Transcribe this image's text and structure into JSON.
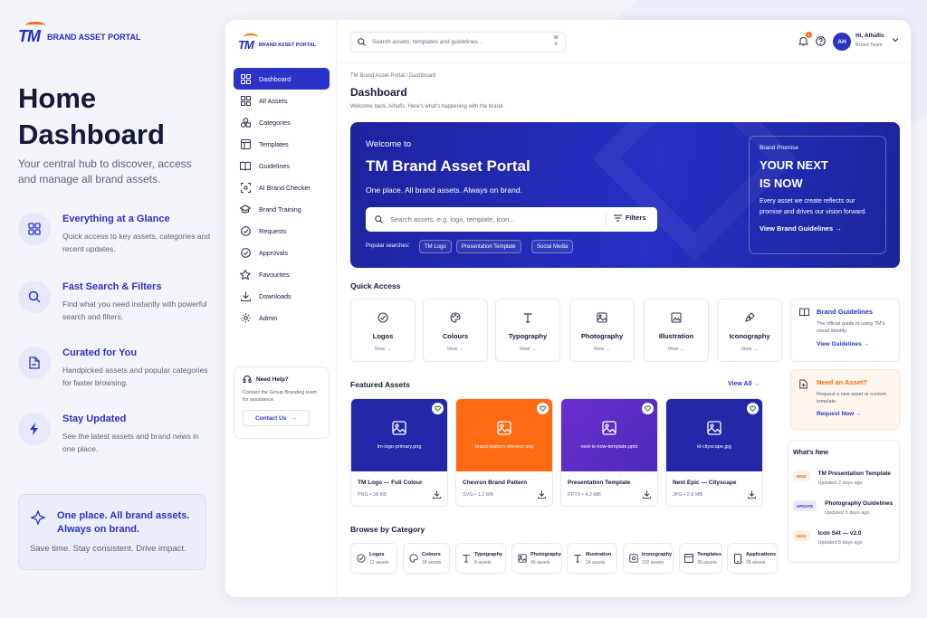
{
  "brand": {
    "logo": "TM",
    "portal_name": "BRAND ASSET PORTAL"
  },
  "hero_left": {
    "title_line1": "Home",
    "title_line2": "Dashboard",
    "subtitle": "Your central hub to discover, access and manage all brand assets.",
    "features": [
      {
        "icon": "grid-icon",
        "title": "Everything at a Glance",
        "text": "Quick access to key assets, categories and recent updates."
      },
      {
        "icon": "search-icon",
        "title": "Fast Search & Filters",
        "text": "Find what you need instantly with powerful search and filters."
      },
      {
        "icon": "document-icon",
        "title": "Curated for You",
        "text": "Handpicked assets and popular categories for faster browsing."
      },
      {
        "icon": "lightning-icon",
        "title": "Stay Updated",
        "text": "See the latest assets and brand news in one place."
      }
    ],
    "promo": {
      "title": "One place. All brand assets. Always on brand.",
      "text": "Save time. Stay consistent. Drive impact."
    }
  },
  "sidebar": {
    "items": [
      {
        "label": "Dashboard",
        "icon": "grid-icon",
        "active": true
      },
      {
        "label": "All Assets",
        "icon": "layers-icon"
      },
      {
        "label": "Categories",
        "icon": "shapes-icon"
      },
      {
        "label": "Templates",
        "icon": "template-icon"
      },
      {
        "label": "Guidelines",
        "icon": "book-icon"
      },
      {
        "label": "AI Brand Checker",
        "icon": "scan-icon"
      },
      {
        "label": "Brand Training",
        "icon": "graduation-cap-icon"
      },
      {
        "label": "Requests",
        "icon": "check-circle-icon"
      },
      {
        "label": "Approvals",
        "icon": "check-circle-icon"
      },
      {
        "label": "Favourites",
        "icon": "star-icon"
      },
      {
        "label": "Downloads",
        "icon": "download-icon"
      },
      {
        "label": "Admin",
        "icon": "gear-icon"
      }
    ],
    "help": {
      "title": "Need Help?",
      "text": "Contact the Group Branding team for assistance.",
      "button": "Contact Us"
    }
  },
  "topbar": {
    "search_placeholder": "Search assets, templates and guidelines...",
    "shortcut_1": "⌘",
    "shortcut_2": "K",
    "notification_count": "1",
    "user": {
      "initials": "AH",
      "name": "Hi, Alhafis",
      "role": "Brand Team"
    }
  },
  "main": {
    "breadcrumb": "TM Brand Asset Portal  /  Dashboard",
    "title": "Dashboard",
    "subtitle": "Welcome back, Alhafis. Here's what's happening with the brand.",
    "hero": {
      "welcome": "Welcome to",
      "title": "TM Brand Asset Portal",
      "tagline": "One place. All brand assets. Always on brand.",
      "search_placeholder": "Search assets, e.g. logo, template, icon...",
      "filters": "Filters",
      "popular_label": "Popular searches:",
      "popular": [
        "TM Logo",
        "Presentation Template",
        "Social Media"
      ],
      "promise": {
        "label": "Brand Promise",
        "title_line1": "YOUR NEXT",
        "title_line2": "IS NOW",
        "text": "Every asset we create reflects our promise and drives our vision forward.",
        "link": "View Brand Guidelines →"
      }
    },
    "quick_access": {
      "title": "Quick Access",
      "items": [
        {
          "label": "Logos",
          "icon": "logo-icon",
          "link": "View →"
        },
        {
          "label": "Colours",
          "icon": "palette-icon",
          "link": "View →"
        },
        {
          "label": "Typography",
          "icon": "typography-icon",
          "link": "View →"
        },
        {
          "label": "Photography",
          "icon": "image-icon",
          "link": "View →"
        },
        {
          "label": "Illustration",
          "icon": "illustration-icon",
          "link": "View →"
        },
        {
          "label": "Iconography",
          "icon": "pen-icon",
          "link": "View →"
        }
      ]
    },
    "brand_guidelines": {
      "title": "Brand Guidelines",
      "text": "The official guide to using TM's visual identity.",
      "link": "View Guidelines →"
    },
    "need_asset": {
      "title": "Need an Asset?",
      "text": "Request a new asset or custom template.",
      "link": "Request Now →"
    },
    "featured": {
      "title": "Featured Assets",
      "view_all": "View All →",
      "items": [
        {
          "filename": "tm-logo-primary.png",
          "title": "TM Logo — Full Colour",
          "meta": "PNG • 28 KB",
          "color": "#2327a8"
        },
        {
          "filename": "brand-pattern-chevron.svg",
          "title": "Chevron Brand Pattern",
          "meta": "SVG • 1.2 MB",
          "color": "#ff6a13"
        },
        {
          "filename": "next-is-now-template.pptx",
          "title": "Presentation Template",
          "meta": "PPTX • 4.2 MB",
          "color": "#5b2bc6"
        },
        {
          "filename": "kl-cityscape.jpg",
          "title": "Next Epic — Cityscape",
          "meta": "JPG • 2.8 MB",
          "color": "#2327a8"
        }
      ]
    },
    "whats_new": {
      "title": "What's New",
      "items": [
        {
          "badge": "NEW",
          "title": "TM Presentation Template",
          "date": "Updated 2 days ago"
        },
        {
          "badge": "UPDATE",
          "title": "Photography Guidelines",
          "date": "Updated 5 days ago"
        },
        {
          "badge": "NEW",
          "title": "Icon Set — v2.0",
          "date": "Updated 8 days ago"
        }
      ]
    },
    "categories": {
      "title": "Browse by Category",
      "items": [
        {
          "label": "Logos",
          "count": "12 assets",
          "icon": "logo-icon"
        },
        {
          "label": "Colours",
          "count": "18 assets",
          "icon": "palette-icon"
        },
        {
          "label": "Typography",
          "count": "8 assets",
          "icon": "typography-icon"
        },
        {
          "label": "Photography",
          "count": "45 assets",
          "icon": "image-icon"
        },
        {
          "label": "Illustration",
          "count": "24 assets",
          "icon": "illustration-icon"
        },
        {
          "label": "Iconography",
          "count": "120 assets",
          "icon": "pen-icon"
        },
        {
          "label": "Templates",
          "count": "36 assets",
          "icon": "template-icon"
        },
        {
          "label": "Applications",
          "count": "28 assets",
          "icon": "phone-icon"
        }
      ]
    }
  },
  "colors": {
    "primary": "#2b33c9",
    "accent": "#ff6a13",
    "hero_bg": "#2530c4",
    "text": "#141a3c"
  }
}
